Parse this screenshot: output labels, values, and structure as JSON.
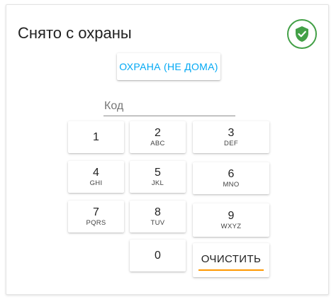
{
  "panel": {
    "title": "Снято с охраны",
    "status_icon": "shield-check-icon",
    "status_color": "#43a047"
  },
  "arm_button": {
    "label": "ОХРАНА (НЕ ДОМА)",
    "color": "#03a9f4"
  },
  "code_input": {
    "placeholder": "Код",
    "value": ""
  },
  "keypad": {
    "keys": [
      {
        "digit": "1",
        "letters": ""
      },
      {
        "digit": "2",
        "letters": "ABC"
      },
      {
        "digit": "3",
        "letters": "DEF"
      },
      {
        "digit": "4",
        "letters": "GHI"
      },
      {
        "digit": "5",
        "letters": "JKL"
      },
      {
        "digit": "6",
        "letters": "MNO"
      },
      {
        "digit": "7",
        "letters": "PQRS"
      },
      {
        "digit": "8",
        "letters": "TUV"
      },
      {
        "digit": "9",
        "letters": "WXYZ"
      },
      {
        "digit": "0",
        "letters": ""
      }
    ],
    "clear_label": "ОЧИСТИТЬ",
    "clear_accent": "#ff9800"
  }
}
